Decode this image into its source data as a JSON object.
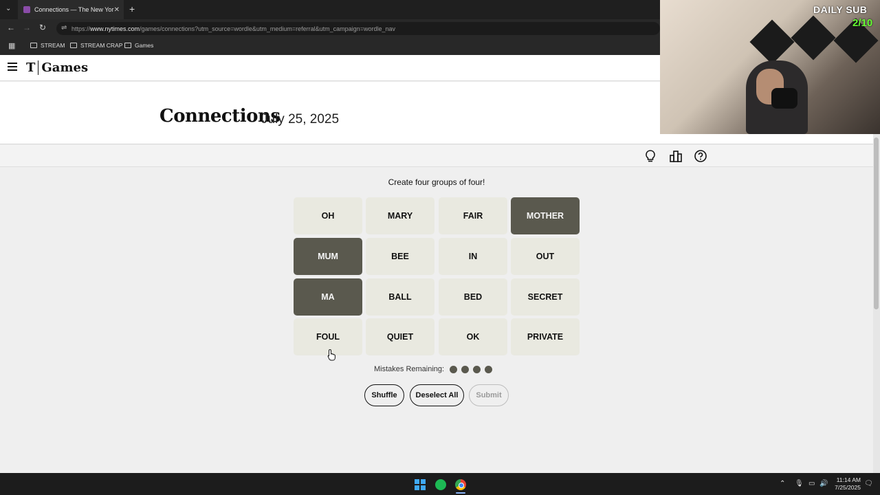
{
  "browser": {
    "tab_title": "Connections — The New York T",
    "tab_close": "✕",
    "new_tab": "+",
    "url_prefix": "https://",
    "url_domain": "www.nytimes.com",
    "url_path": "/games/connections?utm_source=wordle&utm_medium=referral&utm_campaign=wordle_nav",
    "bookmarks": [
      "STREAM",
      "STREAM CRAP",
      "Games"
    ]
  },
  "site": {
    "logo_t": "T",
    "logo_text": "Games"
  },
  "game": {
    "title": "Connections",
    "date": "July 25, 2025",
    "instructions": "Create four groups of four!",
    "tiles": [
      {
        "word": "OH",
        "selected": false
      },
      {
        "word": "MARY",
        "selected": false
      },
      {
        "word": "FAIR",
        "selected": false
      },
      {
        "word": "MOTHER",
        "selected": true
      },
      {
        "word": "MUM",
        "selected": true
      },
      {
        "word": "BEE",
        "selected": false
      },
      {
        "word": "IN",
        "selected": false
      },
      {
        "word": "OUT",
        "selected": false
      },
      {
        "word": "MA",
        "selected": true
      },
      {
        "word": "BALL",
        "selected": false
      },
      {
        "word": "BED",
        "selected": false
      },
      {
        "word": "SECRET",
        "selected": false
      },
      {
        "word": "FOUL",
        "selected": false
      },
      {
        "word": "QUIET",
        "selected": false
      },
      {
        "word": "OK",
        "selected": false
      },
      {
        "word": "PRIVATE",
        "selected": false
      }
    ],
    "mistakes_label": "Mistakes Remaining:",
    "mistakes_remaining": 4,
    "buttons": {
      "shuffle": "Shuffle",
      "deselect_all": "Deselect All",
      "submit": "Submit"
    }
  },
  "overlay": {
    "daily_sub_label": "DAILY SUB",
    "daily_sub_count": "2/10"
  },
  "taskbar": {
    "time": "11:14 AM",
    "date": "7/25/2025"
  },
  "colors": {
    "selected_tile": "#5a594e",
    "unselected_tile": "#e9e9e0",
    "page_background": "#efefef"
  }
}
